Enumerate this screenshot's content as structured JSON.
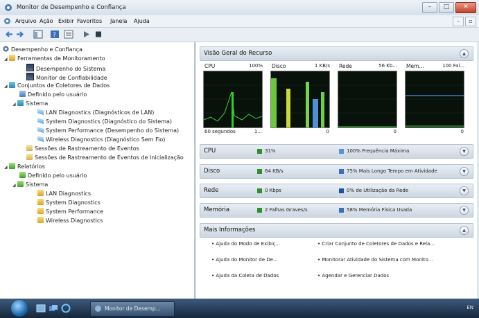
{
  "window": {
    "title": "Monitor de Desempenho e Confiança"
  },
  "menu": {
    "items": [
      "Arquivo",
      "Ação",
      "Exibir",
      "Favoritos",
      "Janela",
      "Ajuda"
    ]
  },
  "tree": {
    "root": "Desempenho e Confiança",
    "tools_folder": "Ferramentas de Monitoramento",
    "perf_monitor": "Desempenho do Sistema",
    "reliability_monitor": "Monitor de Confiabilidade",
    "collector_sets": "Conjuntos de Coletores de Dados",
    "user_defined": "Definido pelo usuário",
    "system": "Sistema",
    "lan_diag": "LAN Diagnostics (Diagnósticos de LAN)",
    "sys_diag": "System Diagnostics (Diagnóstico do Sistema)",
    "sys_perf": "System Performance (Desempenho do Sistema)",
    "wireless_diag": "Wireless Diagnostics (Diagnóstico Sem Fio)",
    "trace_sessions": "Sessões de Rastreamento de Eventos",
    "startup_trace": "Sessões de Rastreamento de Eventos de Inicialização",
    "reports": "Relatórios",
    "reports_user": "Definido pelo usuário",
    "reports_system": "Sistema",
    "r_lan": "LAN Diagnostics",
    "r_sys_diag": "System Diagnostics",
    "r_sys_perf": "System Performance",
    "r_wireless": "Wireless Diagnostics"
  },
  "overview": {
    "title": "Visão Geral do Recurso",
    "graphs": [
      {
        "title": "CPU",
        "scale": "100%",
        "bottom": "60 segundos",
        "bottom_right": "1...",
        "color": "#3fd13f"
      },
      {
        "title": "Disco",
        "scale": "1 KB/s",
        "bottom": "",
        "bottom_right": "0",
        "color": "#58d858"
      },
      {
        "title": "Rede",
        "scale": "56 Kb...",
        "bottom": "",
        "bottom_right": "0",
        "color": "#3fd13f"
      },
      {
        "title": "Mem...",
        "scale": "100 Fal...",
        "bottom": "",
        "bottom_right": "0",
        "color": "#4f8fd8"
      }
    ]
  },
  "metrics": [
    {
      "name": "CPU",
      "green": "31%",
      "blue": "100% Frequência Máxima",
      "green_color": "#2d8f2d",
      "blue_color": "#5b8fd6"
    },
    {
      "name": "Disco",
      "green": "64 KB/s",
      "blue": "75% Mais Longo Tempo em Atividade",
      "green_color": "#2d8f2d",
      "blue_color": "#3b6fc0"
    },
    {
      "name": "Rede",
      "green": "0 Kbps",
      "blue": "0% de Utilização da Rede",
      "green_color": "#2d8f2d",
      "blue_color": "#1f4fa6"
    },
    {
      "name": "Memória",
      "green": "2 Falhas Graves/s",
      "blue": "58% Memória Física Usada",
      "green_color": "#2d8f2d",
      "blue_color": "#3b6fc0"
    }
  ],
  "more_info": {
    "title": "Mais Informações",
    "links": [
      "Ajuda do Modo de Exibiç...",
      "Criar Conjunto de Coletores de Dados e Rela...",
      "Ajuda do Monitor de De...",
      "Monitorar Atividade do Sistema com Monito...",
      "Ajuda da Coleta de Dados",
      "Agendar e Gerenciar Dados"
    ]
  },
  "taskbar": {
    "task_label": "Monitor de Desemp...",
    "tray": "EN"
  }
}
